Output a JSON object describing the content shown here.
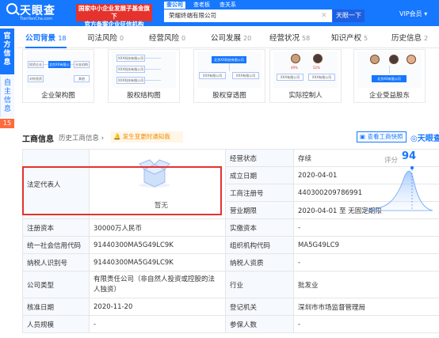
{
  "topbar": {
    "logo_text": "天眼查",
    "logo_sub": "TianYanCha.com",
    "slogan_line1": "国家中小企业发展子基金旗下",
    "slogan_line2": "官方备案企业征信机构",
    "search_tabs": [
      "查公司",
      "查老板",
      "查关系"
    ],
    "search_value": "荣耀终端有限公司",
    "search_button": "天眼一下",
    "vip_label": "VIP会员 ▾",
    "bg_color": "#1677ff"
  },
  "sidebar": {
    "primary_label": "官方信息",
    "secondary_label": "自主信息",
    "badge": "15"
  },
  "tabs": [
    {
      "label": "公司背景",
      "count": "18",
      "active": true
    },
    {
      "label": "司法风险",
      "count": "0"
    },
    {
      "label": "经营风险",
      "count": "0"
    },
    {
      "label": "公司发展",
      "count": "20"
    },
    {
      "label": "经营状况",
      "count": "58"
    },
    {
      "label": "知识产权",
      "count": "5"
    },
    {
      "label": "历史信息",
      "count": "2"
    }
  ],
  "cards": [
    {
      "label": "企业架构图",
      "art": {
        "company": "北京XX有限公司",
        "nodes": [
          "投资企业",
          "分支机构",
          "对外投资",
          "其他"
        ]
      }
    },
    {
      "label": "股权结构图",
      "art": {
        "nodes": [
          "XXX科技有限公司",
          "XXX科技有限公司",
          "XXX科技有限公司"
        ]
      }
    },
    {
      "label": "股权穿透图",
      "art": {
        "company": "北京XX科技有限公司",
        "nodes": [
          "XXX有限公司",
          "XXX有限公司"
        ]
      }
    },
    {
      "label": "实际控制人",
      "art": {
        "percent_a": "49%",
        "percent_b": "52%",
        "nodes": [
          "XXX有限公司",
          "XXX有限公司"
        ]
      }
    },
    {
      "label": "企业受益股东",
      "art": {
        "company": "北京XX有限公司"
      }
    }
  ],
  "section": {
    "title": "工商信息",
    "history": "历史工商信息 ›",
    "notify": "发生变更时通知我",
    "report_button": "查看工商快照",
    "brand": "天眼查"
  },
  "score": {
    "label": "评分",
    "value": "94"
  },
  "info": {
    "legal_rep_label": "法定代表人",
    "legal_rep_value": "暂无",
    "rows_right_top": [
      {
        "label": "经营状态",
        "value": "存续"
      },
      {
        "label": "成立日期",
        "value": "2020-04-01"
      },
      {
        "label": "工商注册号",
        "value": "440300209786991"
      },
      {
        "label": "营业期限",
        "value": "2020-04-01 至 无固定期限"
      }
    ],
    "rows": [
      {
        "l1": "注册资本",
        "v1": "30000万人民币",
        "l2": "实缴资本",
        "v2": "-"
      },
      {
        "l1": "统一社会信用代码",
        "v1": "91440300MA5G49LC9K",
        "l2": "组织机构代码",
        "v2": "MA5G49LC9"
      },
      {
        "l1": "纳税人识别号",
        "v1": "91440300MA5G49LC9K",
        "l2": "纳税人资质",
        "v2": "-"
      },
      {
        "l1": "公司类型",
        "v1": "有限责任公司（非自然人投资或控股的法人独资）",
        "l2": "行业",
        "v2": "批发业"
      },
      {
        "l1": "核准日期",
        "v1": "2020-11-20",
        "l2": "登记机关",
        "v2": "深圳市市场监督管理局"
      },
      {
        "l1": "人员规模",
        "v1": "-",
        "l2": "参保人数",
        "v2": "-"
      }
    ]
  }
}
